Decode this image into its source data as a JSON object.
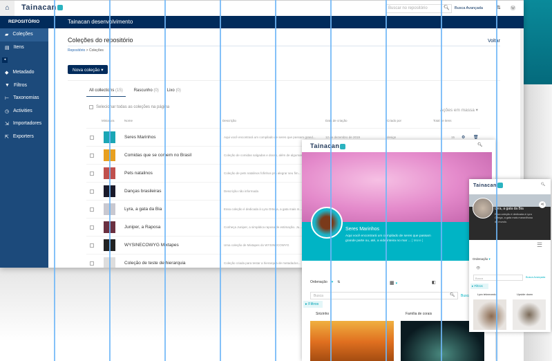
{
  "admin": {
    "logo": "Tainacan",
    "search_placeholder": "Buscar no repositório",
    "advanced_search": "Busca Avançada",
    "site_title": "Tainacan desenvolvimento",
    "sidebar": {
      "header": "REPOSITÓRIO",
      "items": [
        {
          "label": "Coleções",
          "icon": "collections-icon"
        },
        {
          "label": "Itens",
          "icon": "items-icon"
        },
        {
          "label": "Metadado",
          "icon": "tag-icon"
        },
        {
          "label": "Filtros",
          "icon": "filter-icon"
        },
        {
          "label": "Taxonomias",
          "icon": "taxonomy-icon"
        },
        {
          "label": "Activities",
          "icon": "activities-icon"
        },
        {
          "label": "Importadores",
          "icon": "import-icon"
        },
        {
          "label": "Exporters",
          "icon": "export-icon"
        }
      ]
    },
    "page_title": "Coleções do repositório",
    "back": "Voltar",
    "breadcrumb": [
      "Repositório",
      "Coleções"
    ],
    "new_collection": "Nova coleção",
    "tabs": [
      {
        "label": "All collections",
        "count": "(15)"
      },
      {
        "label": "Rascunho",
        "count": "(0)"
      },
      {
        "label": "Lixo",
        "count": "(0)"
      }
    ],
    "select_all": "Selecionar todas as coleções na página",
    "bulk_actions": "Ações em massa",
    "columns": [
      "Miniatura",
      "Nome",
      "Descrição",
      "Data de criação",
      "Criado por",
      "Total de itens"
    ],
    "rows": [
      {
        "name": "Seres Marinhos",
        "desc": "Aqui você encontrará um compilado de seres que passam grand...",
        "date": "12 de dezembro de 2019",
        "author": "design",
        "total": "15",
        "color": "#1aa6b5"
      },
      {
        "name": "Comidas que se comem no Brasil",
        "desc": "Coleção de comidas salgadas e doces, além de algumas...",
        "color": "#e8a020"
      },
      {
        "name": "Pets natalinos",
        "desc": "Coleção de pets natalinos fofinhos pra alegrar seu fim...",
        "color": "#c0504d"
      },
      {
        "name": "Danças brasileiras",
        "desc": "Descrição não informada",
        "color": "#1a1a2a"
      },
      {
        "name": "Lyra, a gata da Bia",
        "desc": "Essa coleção é dedicada à Lyra Ortega, a gata mais m...",
        "color": "#c8c8d0"
      },
      {
        "name": "Juniper, a Raposa",
        "desc": "Conheça Juniper, a simpática raposa de estimação. Ju...",
        "color": "#6a3040"
      },
      {
        "name": "WYSINECOWYG Mixtapes",
        "desc": "Uma coleção de Mixtapes do WYSINECOWYG",
        "color": "#222"
      },
      {
        "name": "Coleção de teste de hierarquia",
        "desc": "Coleção criada para testar a hierarquia de metadados...",
        "color": "#ddd"
      }
    ]
  },
  "theme_desktop": {
    "logo": "Tainacan",
    "collection": "Seres Marinhos",
    "description": "Aqui você encontrará um compilado de seres que passam grande parte ou, até, a vida inteira no mar ...",
    "more": "[ More ]",
    "sort": "Ordenação",
    "search_placeholder": "Busca",
    "advanced_search": "Busca",
    "filters": "Filtros",
    "items": [
      "Sirizinho",
      "Família de corais"
    ]
  },
  "theme_mobile": {
    "logo": "Tainacan",
    "collection": "Lyra, a gata da Bia",
    "description": "Essa coleção é dedicada à Lyra Ortega, a gata mais maravilhosa do mundo.",
    "sort": "Ordenação",
    "search_placeholder": "Busca",
    "advanced_search": "Busca Avançada",
    "filters": "Filtros",
    "items": [
      "Lyra tekneando",
      "Upside down"
    ]
  },
  "colors": {
    "navy": "#012b5b",
    "sidebar": "#1c4a7b",
    "teal": "#00b4c5",
    "grid": "#6fb6f7"
  }
}
